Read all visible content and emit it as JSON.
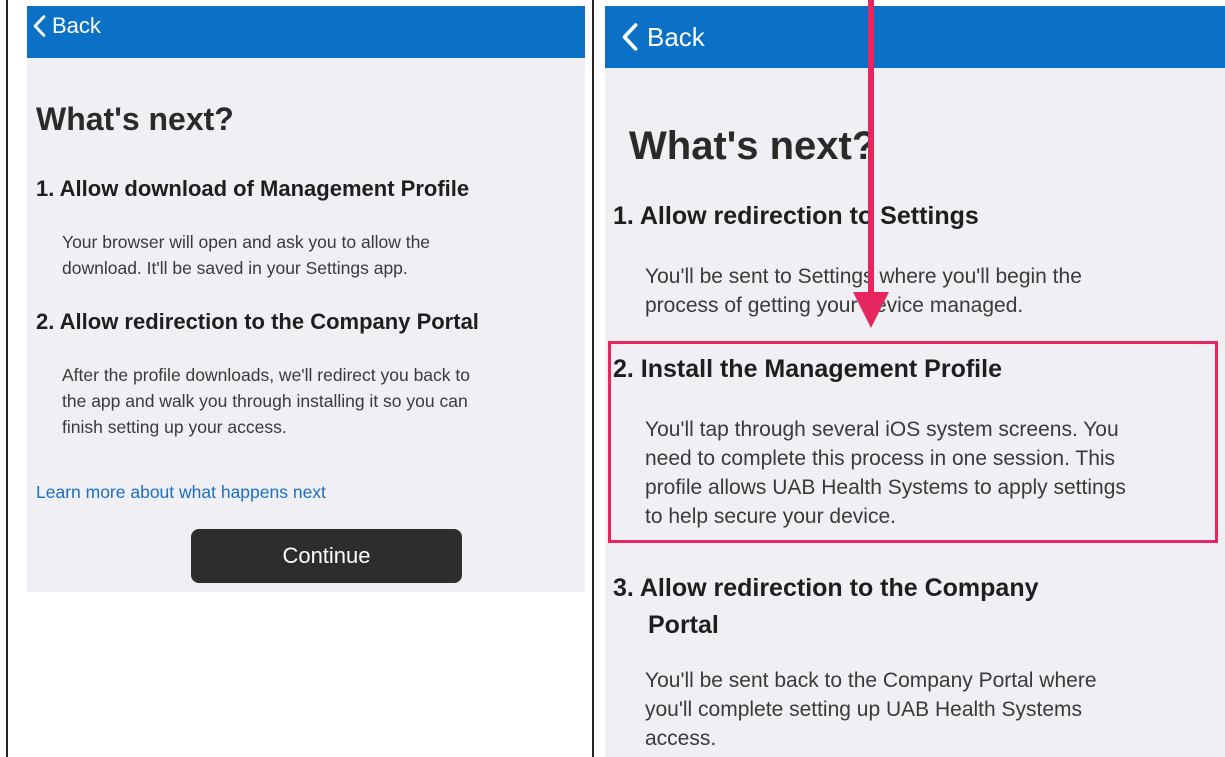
{
  "left": {
    "back_label": "Back",
    "title": "What's next?",
    "steps": [
      {
        "title": "1. Allow download of Management Profile",
        "desc_lines": [
          "Your browser will open and ask you to allow the",
          "download. It'll be saved in your Settings app."
        ]
      },
      {
        "title": "2. Allow redirection to the Company Portal",
        "desc_lines": [
          "After the profile downloads, we'll redirect you back to",
          "the app and walk you through installing it so you can",
          "finish setting up your access."
        ]
      }
    ],
    "learn_more": "Learn more about what happens next",
    "continue_label": "Continue"
  },
  "right": {
    "back_label": "Back",
    "title": "What's next?",
    "steps": [
      {
        "title_lines": [
          "1. Allow redirection to Settings"
        ],
        "desc_lines": [
          "You'll be sent to Settings where you'll begin the",
          "process of getting your device managed."
        ]
      },
      {
        "title_lines": [
          "2. Install the Management Profile"
        ],
        "desc_lines": [
          "You'll tap through several iOS system screens. You",
          "need to complete this process in one session. This",
          "profile allows UAB Health Systems to apply settings",
          "to help secure your device."
        ]
      },
      {
        "title_lines": [
          "3. Allow redirection to the Company",
          "Portal"
        ],
        "desc_lines": [
          "You'll be sent back to the Company Portal where",
          "you'll complete setting up UAB Health Systems",
          "access."
        ]
      }
    ]
  },
  "colors": {
    "nav": "#0a71c6",
    "background": "#efeff4",
    "highlight": "#e6265e",
    "link": "#1a6fc4",
    "button": "#2d2d2d"
  },
  "icons": {
    "back": "chevron-left-icon",
    "annotation": "arrow-down-icon"
  }
}
